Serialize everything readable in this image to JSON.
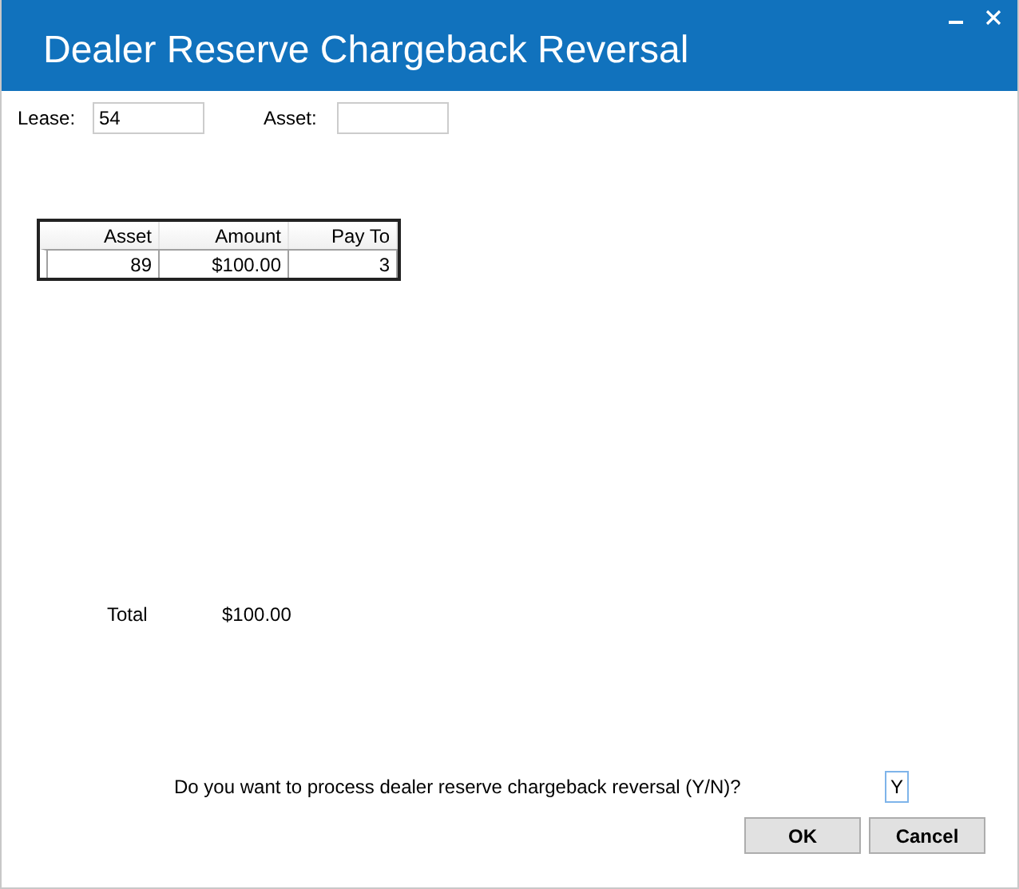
{
  "window": {
    "title": "Dealer Reserve Chargeback Reversal"
  },
  "fields": [
    {
      "label": "Lease:",
      "value": "54"
    },
    {
      "label": "Asset:"
    }
  ],
  "table": {
    "columns": [
      "Asset",
      "Amount",
      "Pay To"
    ],
    "rows": [
      [
        "89",
        "$100.00",
        "3"
      ]
    ]
  },
  "total": {
    "label": "Total",
    "value": "$100.00"
  },
  "question": {
    "text": "Do you want to process dealer reserve chargeback reversal (Y/N)?",
    "value": "Y"
  },
  "buttons": [
    {
      "label": "OK"
    },
    {
      "label": "Cancel"
    }
  ]
}
